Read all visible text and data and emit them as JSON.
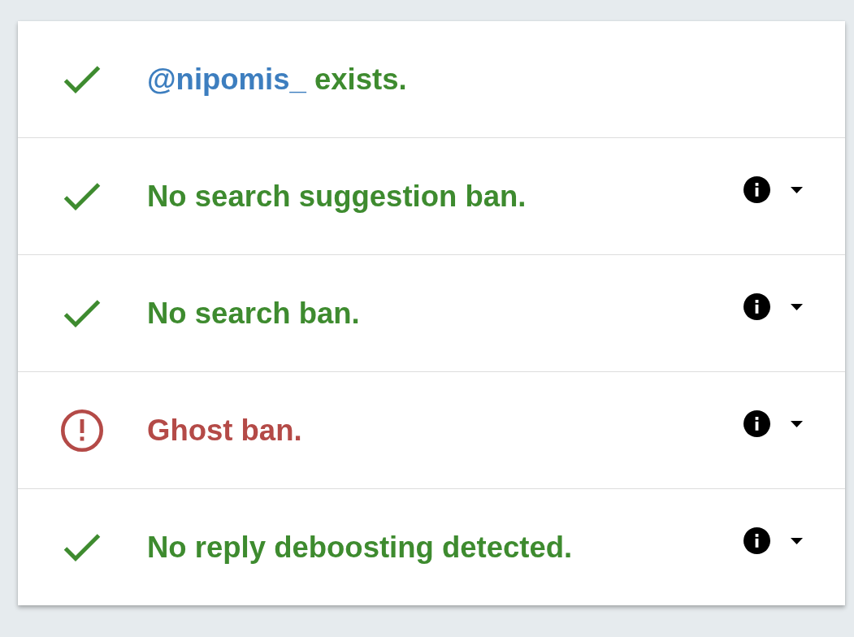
{
  "results": [
    {
      "kind": "account",
      "banned": false,
      "handle": "@nipomis_",
      "text": "exists."
    },
    {
      "kind": "check",
      "banned": false,
      "text": "No search suggestion ban."
    },
    {
      "kind": "check",
      "banned": false,
      "text": "No search ban."
    },
    {
      "kind": "check",
      "banned": true,
      "text": "Ghost ban."
    },
    {
      "kind": "check",
      "banned": false,
      "text": "No reply deboosting detected."
    }
  ]
}
